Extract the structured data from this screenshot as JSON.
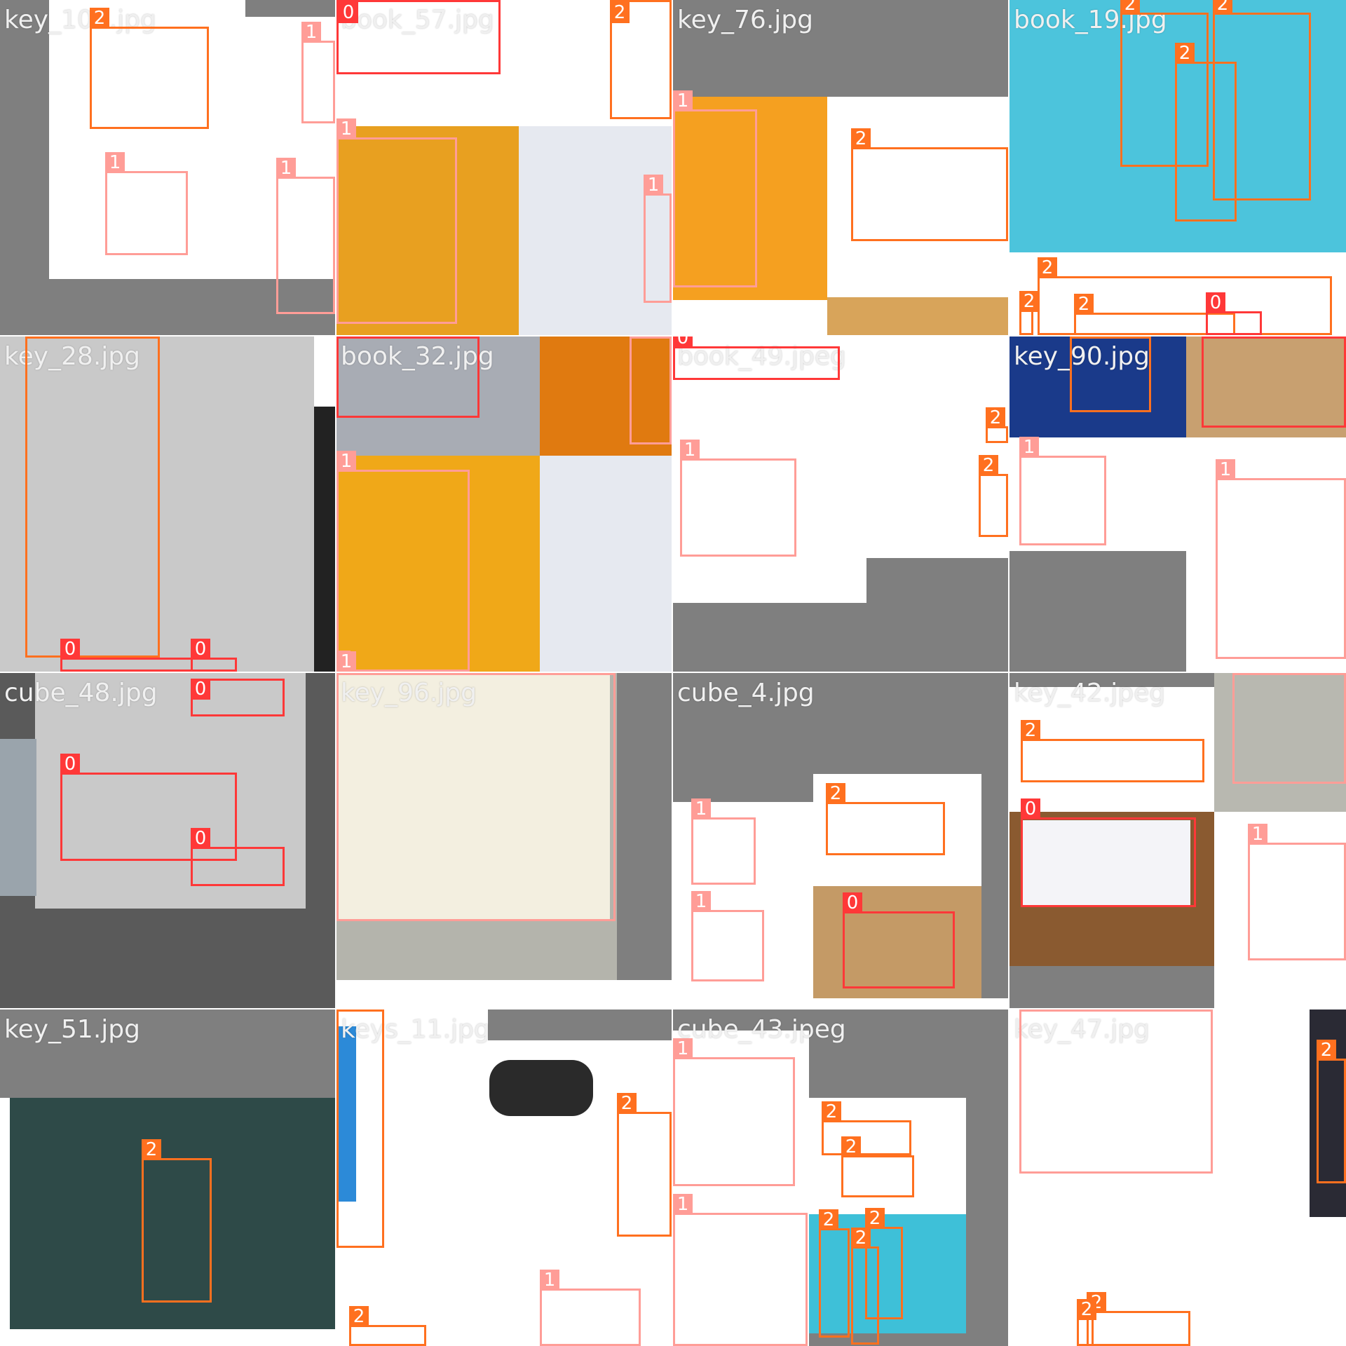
{
  "colors": {
    "class_0": "#ff3838",
    "class_1": "#ff9d97",
    "class_2": "#ff701f",
    "mosaic_gray": "#7f7f7f"
  },
  "tiles": [
    {
      "filename": "key_102.jpg",
      "boxes": [
        "2",
        "1",
        "1",
        "1"
      ]
    },
    {
      "filename": "book_57.jpg",
      "boxes": [
        "0",
        "2",
        "1",
        "1"
      ]
    },
    {
      "filename": "key_76.jpg",
      "boxes": [
        "1",
        "2"
      ]
    },
    {
      "filename": "book_19.jpg",
      "boxes": [
        "2",
        "2",
        "2",
        "2",
        "2",
        "2",
        "0"
      ]
    },
    {
      "filename": "key_28.jpg",
      "boxes": [
        "2",
        "0",
        "0"
      ]
    },
    {
      "filename": "book_32.jpg",
      "boxes": [
        "0",
        "1",
        "1",
        "1"
      ]
    },
    {
      "filename": "book_49.jpeg",
      "boxes": [
        "0",
        "2",
        "2",
        "1"
      ]
    },
    {
      "filename": "key_90.jpg",
      "boxes": [
        "2",
        "0",
        "1",
        "1"
      ]
    },
    {
      "filename": "cube_48.jpg",
      "boxes": [
        "0",
        "0",
        "0"
      ]
    },
    {
      "filename": "key_96.jpg",
      "boxes": [
        "1"
      ]
    },
    {
      "filename": "cube_4.jpg",
      "boxes": [
        "2",
        "1",
        "1",
        "0"
      ]
    },
    {
      "filename": "key_42.jpeg",
      "boxes": [
        "2",
        "0",
        "1",
        "1"
      ]
    },
    {
      "filename": "key_51.jpg",
      "boxes": [
        "2"
      ]
    },
    {
      "filename": "keys_11.jpg",
      "boxes": [
        "2",
        "2",
        "1",
        "2"
      ]
    },
    {
      "filename": "cube_43.jpeg",
      "boxes": [
        "1",
        "2",
        "2",
        "1",
        "2",
        "2",
        "2"
      ]
    },
    {
      "filename": "key_47.jpg",
      "boxes": [
        "1",
        "2",
        "2",
        "2"
      ]
    }
  ]
}
